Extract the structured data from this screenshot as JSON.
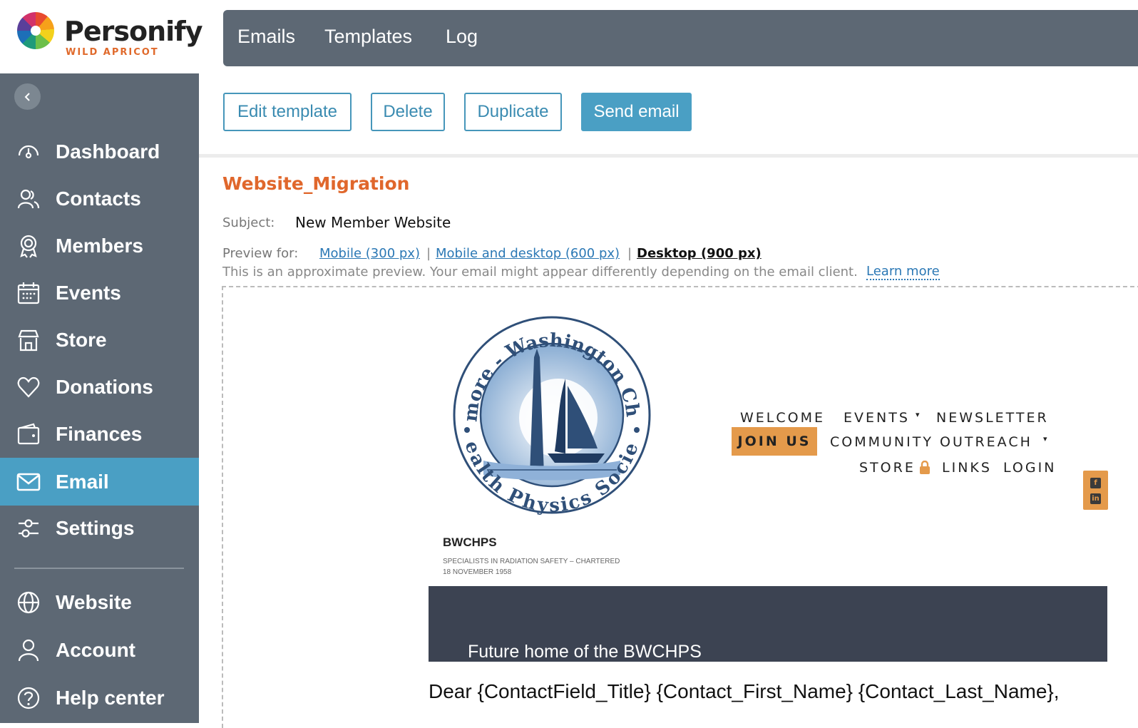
{
  "brand": {
    "name": "Personify",
    "sub": "WILD APRICOT"
  },
  "sidebar": {
    "items": [
      {
        "label": "Dashboard",
        "icon": "dashboard-icon"
      },
      {
        "label": "Contacts",
        "icon": "contacts-icon"
      },
      {
        "label": "Members",
        "icon": "members-icon"
      },
      {
        "label": "Events",
        "icon": "calendar-icon"
      },
      {
        "label": "Store",
        "icon": "store-icon"
      },
      {
        "label": "Donations",
        "icon": "heart-icon"
      },
      {
        "label": "Finances",
        "icon": "wallet-icon"
      },
      {
        "label": "Email",
        "icon": "envelope-icon",
        "active": true
      },
      {
        "label": "Settings",
        "icon": "sliders-icon"
      },
      {
        "label": "Website",
        "icon": "globe-icon"
      },
      {
        "label": "Account",
        "icon": "user-icon"
      },
      {
        "label": "Help center",
        "icon": "help-icon"
      }
    ]
  },
  "topbar": {
    "tabs": [
      "Emails",
      "Templates",
      "Log"
    ]
  },
  "toolbar": {
    "edit": "Edit template",
    "delete": "Delete",
    "duplicate": "Duplicate",
    "send": "Send email"
  },
  "template": {
    "title": "Website_Migration",
    "subject_label": "Subject:",
    "subject": "New Member Website",
    "preview_label": "Preview for:",
    "preview_mobile": "Mobile (300 px)",
    "preview_mobile_desktop": "Mobile and desktop (600 px)",
    "preview_desktop": "Desktop (900 px)",
    "separator": "|",
    "approx_note": "This is an approximate preview. Your email might appear differently depending on the email client.",
    "learn_more": "Learn more"
  },
  "email": {
    "logo_top": "Baltimore - Washington Chapter",
    "logo_bottom": "Health Physics Society",
    "nav": {
      "welcome": "WELCOME",
      "events": "EVENTS",
      "newsletter": "NEWSLETTER",
      "join": "JOIN US",
      "outreach": "COMMUNITY OUTREACH",
      "store": "STORE",
      "links": "LINKS",
      "login": "LOGIN"
    },
    "org_name": "BWCHPS",
    "org_tagline": "SPECIALISTS IN RADIATION SAFETY – CHARTERED 18 NOVEMBER 1958",
    "hero_text": "Future home of the BWCHPS",
    "greeting": "Dear {ContactField_Title} {Contact_First_Name} {Contact_Last_Name},"
  },
  "colors": {
    "sidebar": "#5d6874",
    "active": "#4a9fc4",
    "title_orange": "#e0672c",
    "join_orange": "#e49a4b",
    "hero": "#3c4352"
  }
}
